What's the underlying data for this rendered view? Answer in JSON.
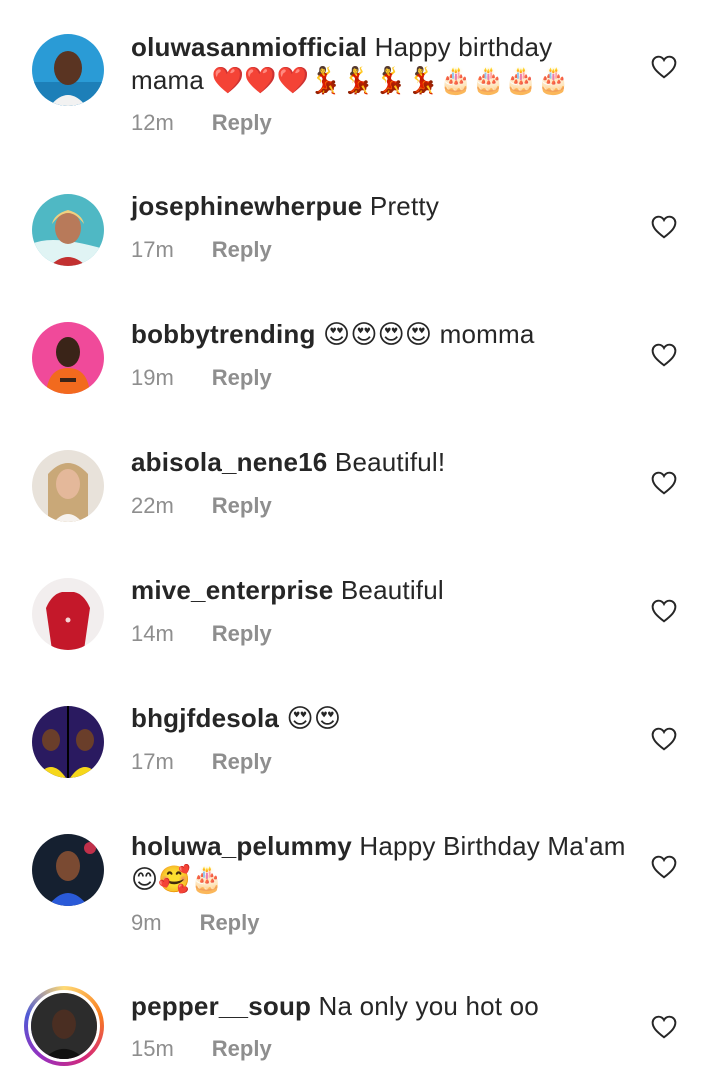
{
  "comments": [
    {
      "username": "oluwasanmiofficial",
      "text": "Happy birthday mama ❤️❤️❤️💃💃💃💃🎂🎂🎂🎂",
      "time": "12m",
      "reply": "Reply",
      "avatar_color": "#2a9bd6"
    },
    {
      "username": "josephinewherpue",
      "text": "Pretty",
      "time": "17m",
      "reply": "Reply",
      "avatar_color": "#4fb8c4"
    },
    {
      "username": "bobbytrending",
      "text": "😍😍😍😍 momma",
      "time": "19m",
      "reply": "Reply",
      "avatar_color": "#f04a9a"
    },
    {
      "username": "abisola_nene16",
      "text": "Beautiful!",
      "time": "22m",
      "reply": "Reply",
      "avatar_color": "#c9b39a"
    },
    {
      "username": "mive_enterprise",
      "text": "Beautiful",
      "time": "14m",
      "reply": "Reply",
      "avatar_color": "#c4182a"
    },
    {
      "username": "bhgjfdesola",
      "text": "😍😍",
      "time": "17m",
      "reply": "Reply",
      "avatar_color": "#2a1a60"
    },
    {
      "username": "holuwa_pelummy",
      "text": "Happy Birthday Ma'am 😊🥰🎂",
      "time": "9m",
      "reply": "Reply",
      "avatar_color": "#152030"
    },
    {
      "username": "pepper__soup",
      "text": "Na only you hot oo",
      "time": "15m",
      "reply": "Reply",
      "avatar_color": "#2c2c2c"
    }
  ],
  "icons": {
    "like": "heart-outline-icon"
  },
  "colors": {
    "text": "#262626",
    "meta": "#8e8e8e"
  }
}
